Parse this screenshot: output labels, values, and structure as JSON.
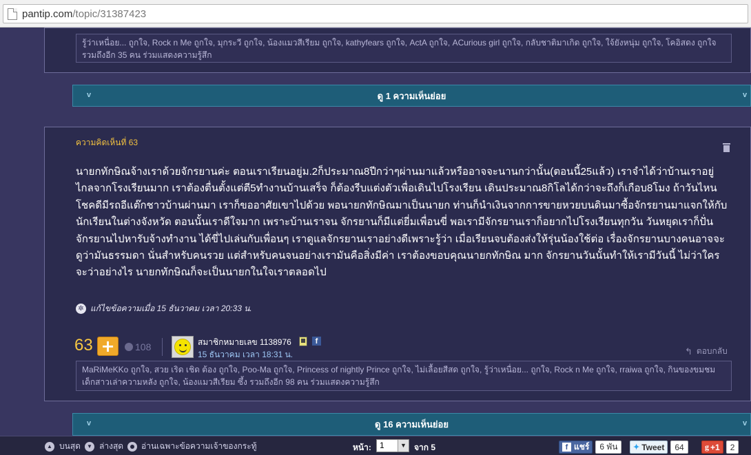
{
  "browser": {
    "url_host": "pantip.com",
    "url_path": "/topic/31387423"
  },
  "prev_comment": {
    "likers": "รู้ว่าเหนื่อย... ถูกใจ, Rock n Me ถูกใจ, มุกระวี ถูกใจ, น้องแมวสีเรียม ถูกใจ, kathyfears ถูกใจ, ActA ถูกใจ, ACurious girl ถูกใจ, กลับชาติมาเกิด ถูกใจ, ใจ้ยังหนุ่ม ถูกใจ, โคอิสดง ถูกใจ รวมถึงอีก 35 คน ร่วมแสดงความรู้สึก",
    "expand_label": "ดู 1 ความเห็นย่อย"
  },
  "comment": {
    "title": "ความคิดเห็นที่ 63",
    "body": "นายกทักษิณจ้างเราด้วยจักรยานค่ะ ตอนเราเรียนอยู่ม.2ก็ประมาณ8ปีกว่าๆผ่านมาแล้วหรืออาจจะนานกว่านั้น(ตอนนี้25แล้ว) เราจำได้ว่าบ้านเราอยู่ไกลจากโรงเรียนมาก เราต้องตื่นตั้งแต่ตี5ทำงานบ้านเสร็จ ก็ต้องรีบแต่งตัวเพื่อเดินไปโรงเรียน เดินประมาณ8กิโลได้กว่าจะถึงก็เกือบ8โมง ถ้าวันไหนโชคดีมีรถอีแต๊กชาวบ้านผ่านมา เราก็ขออาศัยเขาไปด้วย พอนายกทักษิณมาเป็นนายก ท่านก็นำเงินจากการขายหวยบนดินมาซื้อจักรยานมาแจกให้กับนักเรียนในต่างจังหวัด ตอนนั้นเราดีใจมาก เพราะบ้านเราจน จักรยานก็มีแต่ยี่มเพื่อนขี่ พอเรามีจักรยานเราก็อยากไปโรงเรียนทุกวัน วันหยุดเราก็ปั่นจักรยานไปหารับจ้างทำงาน ได้ขี่ไปเล่นกับเพื่อนๆ เราดูแลจักรยานเราอย่างดีเพราะรู้ว่า เมื่อเรียนจบต้องส่งให้รุ่นน้องใช้ต่อ เรื่องจักรยานบางคนอาจจะดูว่ามันธรรมดา นั่นสำหรับคนรวย แต่สำหรับคนจนอย่างเรามันคือสิ่งมีค่า เราต้องขอบคุณนายกทักษิณ มาก จักรยานวันนั้นทำให้เรามีวันนี้ ไม่ว่าใครจะว่าอย่างไร นายกทักษิณก็จะเป็นนายกในใจเราตลอดไป",
    "edited": "แก้ไขข้อความเมื่อ 15 ธันวาคม เวลา 20:33 น.",
    "score": "63",
    "emotions": "108",
    "member": "สมาชิกหมายเลข 1138976",
    "time": "15 ธันวาคม เวลา 18:31 น.",
    "reply_label": "ตอบกลับ",
    "likers": "MaRiMeKKo ถูกใจ, สวย เริด เชิด ต้อง ถูกใจ, Poo-Ma ถูกใจ, Princess of nightly Prince ถูกใจ, ไม่เลื้อยสีสด ถูกใจ, รู้ว่าเหนื่อย... ถูกใจ, Rock n Me ถูกใจ, rraiwa ถูกใจ, กินของขมชมเด็กสาวเล่าความหลัง ถูกใจ, น้องแมวสีเรียม ซึ้ง รวมถึงอีก 98 คน ร่วมแสดงความรู้สึก",
    "expand_label": "ดู 16 ความเห็นย่อย"
  },
  "bottom": {
    "top_label": "บนสุด",
    "bottom_label": "ล่างสุด",
    "owner_only_label": "อ่านเฉพาะข้อความเจ้าของกระทู้",
    "page_label": "หน้า:",
    "page_value": "1",
    "of_label": "จาก 5",
    "fb_label": "แชร์",
    "fb_count": "6 พัน",
    "tweet_label": "Tweet",
    "tweet_count": "64",
    "gplus_label": "+1",
    "gplus_count": "2"
  },
  "colors": {
    "background": "#383660",
    "accent_title": "#f0c040",
    "expand_bar": "#1e5d78"
  }
}
